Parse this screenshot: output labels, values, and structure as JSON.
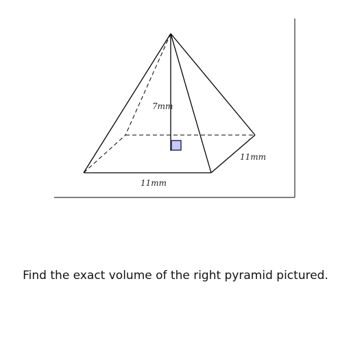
{
  "figure": {
    "height_label": "7mm",
    "base_front_label": "11mm",
    "base_side_label": "11mm",
    "right_angle_fill": "#c8c8f0",
    "right_angle_stroke": "#2a2a6a"
  },
  "question": {
    "text": "Find the exact volume of the right pyramid pictured."
  }
}
